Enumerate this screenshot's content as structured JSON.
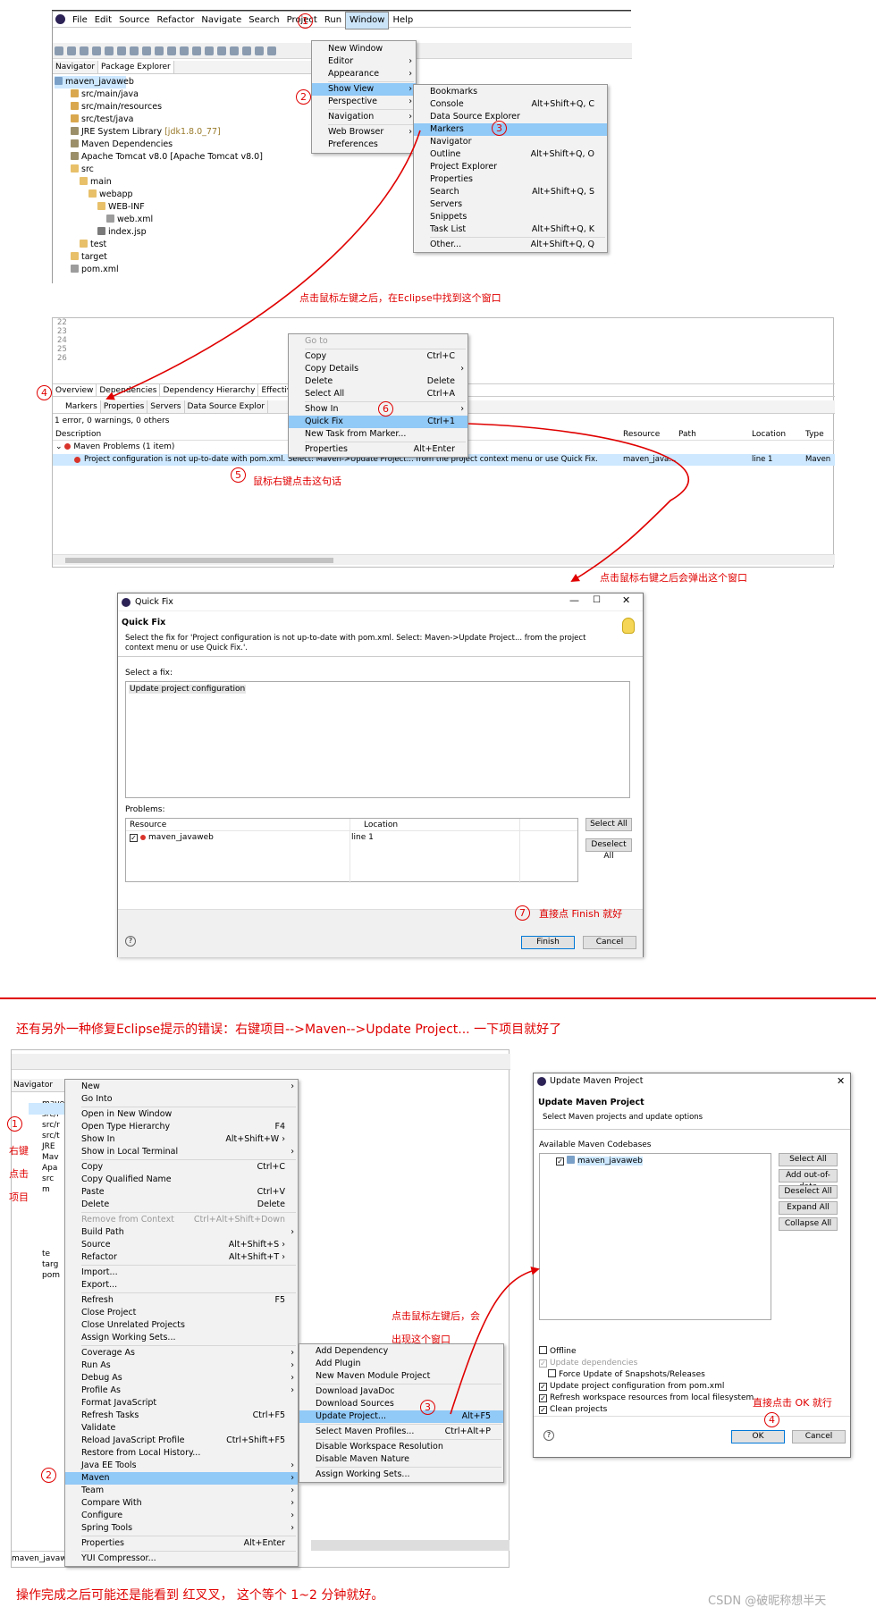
{
  "s1": {
    "menubar": [
      "File",
      "Edit",
      "Source",
      "Refactor",
      "Navigate",
      "Search",
      "Project",
      "Run",
      "Window",
      "Help"
    ],
    "view_tabs": [
      "Navigator",
      "Package Explorer"
    ],
    "tree": [
      {
        "t": "maven_javaweb",
        "i": "project-icon",
        "d": 0,
        "sel": true
      },
      {
        "t": "src/main/java",
        "i": "package-folder-icon",
        "d": 1
      },
      {
        "t": "src/main/resources",
        "i": "package-folder-icon",
        "d": 1
      },
      {
        "t": "src/test/java",
        "i": "package-folder-icon",
        "d": 1
      },
      {
        "t": "JRE System Library",
        "x": "[jdk1.8.0_77]",
        "i": "library-icon",
        "d": 1
      },
      {
        "t": "Maven Dependencies",
        "i": "library-icon",
        "d": 1
      },
      {
        "t": "Apache Tomcat v8.0 [Apache Tomcat v8.0]",
        "i": "library-icon",
        "d": 1
      },
      {
        "t": "src",
        "i": "folder-icon",
        "d": 1
      },
      {
        "t": "main",
        "i": "folder-icon",
        "d": 2
      },
      {
        "t": "webapp",
        "i": "folder-icon",
        "d": 3
      },
      {
        "t": "WEB-INF",
        "i": "folder-icon",
        "d": 4
      },
      {
        "t": "web.xml",
        "i": "xml-file-icon",
        "d": 5
      },
      {
        "t": "index.jsp",
        "i": "jsp-file-icon",
        "d": 4
      },
      {
        "t": "test",
        "i": "folder-icon",
        "d": 2
      },
      {
        "t": "target",
        "i": "folder-icon",
        "d": 1
      },
      {
        "t": "pom.xml",
        "i": "xml-file-icon",
        "d": 1
      }
    ],
    "window_menu": [
      {
        "l": "New Window",
        "a": ""
      },
      {
        "l": "Editor",
        "a": "›"
      },
      {
        "l": "Appearance",
        "a": "›"
      },
      "-",
      {
        "l": "Show View",
        "a": "›",
        "sel": true
      },
      {
        "l": "Perspective",
        "a": "›"
      },
      "-",
      {
        "l": "Navigation",
        "a": "›"
      },
      "-",
      {
        "l": "Web Browser",
        "a": "›"
      },
      {
        "l": "Preferences",
        "a": ""
      }
    ],
    "show_view_menu": [
      {
        "l": "Bookmarks",
        "k": ""
      },
      {
        "l": "Console",
        "k": "Alt+Shift+Q, C"
      },
      {
        "l": "Data Source Explorer",
        "k": ""
      },
      {
        "l": "Markers",
        "k": "",
        "sel": true
      },
      {
        "l": "Navigator",
        "k": ""
      },
      {
        "l": "Outline",
        "k": "Alt+Shift+Q, O"
      },
      {
        "l": "Project Explorer",
        "k": ""
      },
      {
        "l": "Properties",
        "k": ""
      },
      {
        "l": "Search",
        "k": "Alt+Shift+Q, S"
      },
      {
        "l": "Servers",
        "k": ""
      },
      {
        "l": "Snippets",
        "k": ""
      },
      {
        "l": "Task List",
        "k": "Alt+Shift+Q, K"
      },
      "-",
      {
        "l": "Other...",
        "k": "Alt+Shift+Q, Q"
      }
    ],
    "note": "点击鼠标左键之后，在Eclipse中找到这个窗口"
  },
  "s2": {
    "line_numbers": [
      "22",
      "23",
      "24",
      "25",
      "26"
    ],
    "pom_tabs": [
      "Overview",
      "Dependencies",
      "Dependency Hierarchy",
      "Effective POM"
    ],
    "view_tabs": [
      "Markers",
      "Properties",
      "Servers",
      "Data Source Explor"
    ],
    "summary": "1 error, 0 warnings, 0 others",
    "columns": [
      "Description",
      "Resource",
      "Path",
      "Location",
      "Type"
    ],
    "group": "Maven Problems (1 item)",
    "row": {
      "desc": "Project configuration is not up-to-date with pom.xml. Select: Maven->Update Project... from the project context menu or use Quick Fix.",
      "res": "maven_java...",
      "path": "",
      "loc": "line 1",
      "type": "Maven"
    },
    "context_menu": [
      {
        "l": "Go to",
        "k": "",
        "dis": true
      },
      "-",
      {
        "l": "Copy",
        "k": "Ctrl+C"
      },
      {
        "l": "Copy Details",
        "k": "›"
      },
      {
        "l": "Delete",
        "k": "Delete"
      },
      {
        "l": "Select All",
        "k": "Ctrl+A"
      },
      "-",
      {
        "l": "Show In",
        "k": "›"
      },
      {
        "l": "Quick Fix",
        "k": "Ctrl+1",
        "sel": true
      },
      {
        "l": "New Task from Marker...",
        "k": ""
      },
      "-",
      {
        "l": "Properties",
        "k": "Alt+Enter"
      }
    ],
    "note_row": "鼠标右键点击这句话",
    "note_popup": "点击鼠标右键之后会弹出这个窗口"
  },
  "qf": {
    "title": "Quick Fix",
    "heading": "Quick Fix",
    "desc": "Select the fix for 'Project configuration is not up-to-date with pom.xml. Select: Maven->Update Project... from the project context menu or use Quick Fix.'.",
    "select_label": "Select a fix:",
    "fix": "Update project configuration",
    "problems_label": "Problems:",
    "col_resource": "Resource",
    "col_location": "Location",
    "prob_res": "maven_javaweb",
    "prob_loc": "line 1",
    "select_all": "Select All",
    "deselect_all": "Deselect All",
    "finish": "Finish",
    "cancel": "Cancel",
    "note": "直接点 Finish 就好"
  },
  "divider_text": "还有另外一种修复Eclipse提示的错误：右键项目-->Maven-->Update Project... 一下项目就好了",
  "s3": {
    "left_note": [
      "右键",
      "点击",
      "项目"
    ],
    "tree": [
      "maven",
      "src/r",
      "src/r",
      "src/t",
      "JRE",
      "Mav",
      "Apa",
      "src",
      "m",
      "",
      "",
      "",
      "",
      "",
      "te",
      "targ",
      "pom"
    ],
    "bottom_tab": "maven_javaw",
    "ctx": [
      {
        "l": "New",
        "k": "›"
      },
      {
        "l": "Go Into",
        "k": ""
      },
      "-",
      {
        "l": "Open in New Window",
        "k": ""
      },
      {
        "l": "Open Type Hierarchy",
        "k": "F4"
      },
      {
        "l": "Show In",
        "k": "Alt+Shift+W ›"
      },
      {
        "l": "Show in Local Terminal",
        "k": "›"
      },
      "-",
      {
        "l": "Copy",
        "k": "Ctrl+C"
      },
      {
        "l": "Copy Qualified Name",
        "k": ""
      },
      {
        "l": "Paste",
        "k": "Ctrl+V"
      },
      {
        "l": "Delete",
        "k": "Delete"
      },
      "-",
      {
        "l": "Remove from Context",
        "k": "Ctrl+Alt+Shift+Down",
        "dis": true
      },
      {
        "l": "Build Path",
        "k": "›"
      },
      {
        "l": "Source",
        "k": "Alt+Shift+S ›"
      },
      {
        "l": "Refactor",
        "k": "Alt+Shift+T ›"
      },
      "-",
      {
        "l": "Import...",
        "k": ""
      },
      {
        "l": "Export...",
        "k": ""
      },
      "-",
      {
        "l": "Refresh",
        "k": "F5"
      },
      {
        "l": "Close Project",
        "k": ""
      },
      {
        "l": "Close Unrelated Projects",
        "k": ""
      },
      {
        "l": "Assign Working Sets...",
        "k": ""
      },
      "-",
      {
        "l": "Coverage As",
        "k": "›"
      },
      {
        "l": "Run As",
        "k": "›"
      },
      {
        "l": "Debug As",
        "k": "›"
      },
      {
        "l": "Profile As",
        "k": "›"
      },
      {
        "l": "Format JavaScript",
        "k": ""
      },
      {
        "l": "Refresh Tasks",
        "k": "Ctrl+F5"
      },
      {
        "l": "Validate",
        "k": ""
      },
      {
        "l": "Reload JavaScript Profile",
        "k": "Ctrl+Shift+F5"
      },
      {
        "l": "Restore from Local History...",
        "k": ""
      },
      {
        "l": "Java EE Tools",
        "k": "›"
      },
      {
        "l": "Maven",
        "k": "›",
        "sel": true
      },
      {
        "l": "Team",
        "k": "›"
      },
      {
        "l": "Compare With",
        "k": "›"
      },
      {
        "l": "Configure",
        "k": "›"
      },
      {
        "l": "Spring Tools",
        "k": "›"
      },
      "-",
      {
        "l": "Properties",
        "k": "Alt+Enter"
      },
      "-",
      {
        "l": "YUI Compressor...",
        "k": ""
      }
    ],
    "maven_menu": [
      {
        "l": "Add Dependency",
        "k": ""
      },
      {
        "l": "Add Plugin",
        "k": ""
      },
      {
        "l": "New Maven Module Project",
        "k": ""
      },
      "-",
      {
        "l": "Download JavaDoc",
        "k": ""
      },
      {
        "l": "Download Sources",
        "k": ""
      },
      {
        "l": "Update Project...",
        "k": "Alt+F5",
        "sel": true
      },
      "-",
      {
        "l": "Select Maven Profiles...",
        "k": "Ctrl+Alt+P"
      },
      "-",
      {
        "l": "Disable Workspace Resolution",
        "k": ""
      },
      {
        "l": "Disable Maven Nature",
        "k": ""
      },
      "-",
      {
        "l": "Assign Working Sets...",
        "k": ""
      }
    ],
    "note_popup": [
      "点击鼠标左键后，会",
      "出现这个窗口"
    ]
  },
  "um": {
    "title": "Update Maven Project",
    "heading": "Update Maven Project",
    "desc": "Select Maven projects and update options",
    "codebases_label": "Available Maven Codebases",
    "project": "maven_javaweb",
    "buttons": [
      "Select All",
      "Add out-of-date",
      "Deselect All",
      "Expand All",
      "Collapse All"
    ],
    "options": [
      {
        "l": "Offline",
        "c": false,
        "dis": false,
        "ind": false
      },
      {
        "l": "Update dependencies",
        "c": true,
        "dis": true,
        "ind": false
      },
      {
        "l": "Force Update of Snapshots/Releases",
        "c": false,
        "dis": false,
        "ind": true
      },
      {
        "l": "Update project configuration from pom.xml",
        "c": true,
        "dis": false,
        "ind": false
      },
      {
        "l": "Refresh workspace resources from local filesystem",
        "c": true,
        "dis": false,
        "ind": false
      },
      {
        "l": "Clean projects",
        "c": true,
        "dis": false,
        "ind": false
      }
    ],
    "ok": "OK",
    "cancel": "Cancel",
    "note": "直接点击 OK 就行"
  },
  "bottom_note": "操作完成之后可能还是能看到 红叉叉， 这个等个 1~2 分钟就好。",
  "watermark": "CSDN @破昵称想半天",
  "colors": {
    "accent": "#e00000",
    "selection": "#91c9f7",
    "folder": "#e8c06a",
    "package": "#d9a84e",
    "error": "#d9342b"
  }
}
